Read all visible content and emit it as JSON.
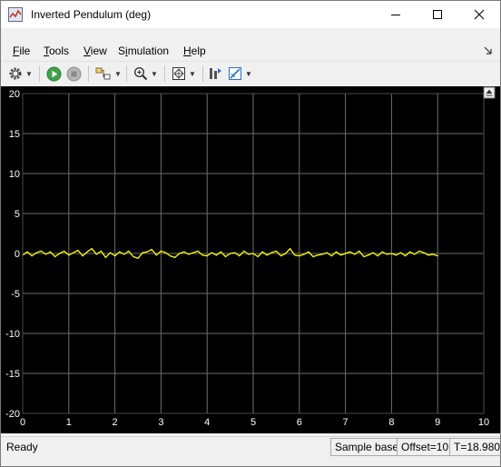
{
  "window": {
    "title": "Inverted Pendulum (deg)",
    "controls": [
      "minimize-icon",
      "maximize-icon",
      "close-icon"
    ]
  },
  "menu": {
    "items": [
      {
        "underlined": "F",
        "rest": "ile"
      },
      {
        "underlined": "T",
        "rest": "ools"
      },
      {
        "underlined": "V",
        "rest": "iew"
      },
      {
        "lead": "S",
        "underlined": "i",
        "rest": "mulation"
      },
      {
        "underlined": "H",
        "rest": "elp"
      }
    ]
  },
  "toolbar": {
    "icons": [
      "settings-gear-icon",
      "run-icon",
      "stop-icon",
      "highlight-block-icon",
      "zoom-in-icon",
      "autoscale-icon",
      "cursor-measurements-icon",
      "signal-statistics-icon"
    ]
  },
  "status": {
    "ready": "Ready",
    "mode": "Sample based",
    "offset": "Offset=10",
    "time": "T=18.980"
  },
  "colors": {
    "background": "#000000",
    "grid": "#6e6e6e",
    "signal": "#ffff00",
    "axis_text": "#ffffff"
  },
  "chart_data": {
    "type": "line",
    "title": "",
    "xlabel": "",
    "ylabel": "",
    "xlim": [
      0,
      10
    ],
    "ylim": [
      -20,
      20
    ],
    "xticks": [
      0,
      1,
      2,
      3,
      4,
      5,
      6,
      7,
      8,
      9,
      10
    ],
    "yticks": [
      20,
      15,
      10,
      5,
      0,
      -5,
      -10,
      -15,
      -20
    ],
    "grid": true,
    "series": [
      {
        "x": [
          0.0,
          0.1,
          0.2,
          0.3,
          0.4,
          0.5,
          0.6,
          0.7,
          0.8,
          0.9,
          1.0,
          1.1,
          1.2,
          1.3,
          1.4,
          1.5,
          1.6,
          1.7,
          1.8,
          1.9,
          2.0,
          2.1,
          2.2,
          2.3,
          2.4,
          2.5,
          2.6,
          2.7,
          2.8,
          2.9,
          3.0,
          3.1,
          3.2,
          3.3,
          3.4,
          3.5,
          3.6,
          3.7,
          3.8,
          3.9,
          4.0,
          4.1,
          4.2,
          4.3,
          4.4,
          4.5,
          4.6,
          4.7,
          4.8,
          4.9,
          5.0,
          5.1,
          5.2,
          5.3,
          5.4,
          5.5,
          5.6,
          5.7,
          5.8,
          5.9,
          6.0,
          6.1,
          6.2,
          6.3,
          6.4,
          6.5,
          6.6,
          6.7,
          6.8,
          6.9,
          7.0,
          7.1,
          7.2,
          7.3,
          7.4,
          7.5,
          7.6,
          7.7,
          7.8,
          7.9,
          8.0,
          8.1,
          8.2,
          8.3,
          8.4,
          8.5,
          8.6,
          8.7,
          8.8,
          8.9,
          9.0
        ],
        "y": [
          -0.2,
          0.2,
          -0.3,
          0.1,
          0.3,
          -0.1,
          0.2,
          -0.4,
          0.0,
          0.3,
          -0.2,
          0.1,
          0.4,
          -0.3,
          0.2,
          0.6,
          -0.1,
          0.3,
          -0.5,
          0.1,
          -0.3,
          0.2,
          -0.1,
          0.3,
          -0.4,
          -0.6,
          0.1,
          0.2,
          0.5,
          -0.2,
          0.3,
          0.1,
          -0.3,
          -0.5,
          0.0,
          0.2,
          -0.1,
          0.1,
          0.3,
          -0.2,
          -0.3,
          0.1,
          -0.2,
          0.2,
          -0.4,
          0.0,
          0.1,
          -0.3,
          0.3,
          -0.1,
          0.0,
          -0.4,
          0.2,
          -0.2,
          0.1,
          0.3,
          -0.3,
          0.0,
          0.6,
          -0.2,
          -0.3,
          -0.1,
          0.2,
          -0.4,
          -0.2,
          -0.1,
          0.1,
          -0.3,
          0.2,
          -0.2,
          0.0,
          0.2,
          -0.1,
          0.3,
          -0.4,
          -0.2,
          0.1,
          -0.3,
          0.2,
          -0.1,
          0.0,
          -0.2,
          0.1,
          -0.3,
          0.2,
          -0.1,
          0.3,
          0.1,
          -0.2,
          -0.1,
          -0.3
        ]
      }
    ]
  }
}
